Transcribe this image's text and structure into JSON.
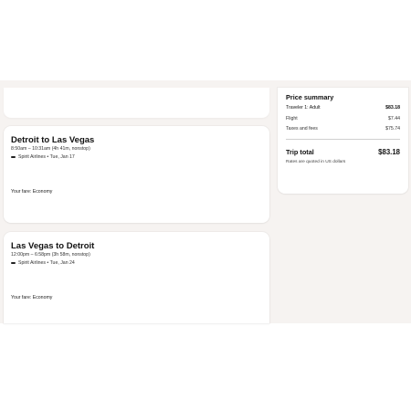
{
  "flights": [
    {
      "title": "Detroit to Las Vegas",
      "time": "8:50am – 10:31am (4h 41m, nonstop)",
      "airline_line": "Spirit Airlines • Tue, Jan 17",
      "fare": "Your fare: Economy"
    },
    {
      "title": "Las Vegas to Detroit",
      "time": "12:00pm – 6:58pm (3h 58m, nonstop)",
      "airline_line": "Spirit Airlines • Tue, Jan 24",
      "fare": "Your fare: Economy"
    }
  ],
  "price_summary": {
    "title": "Price summary",
    "traveler_label": "Traveler 1: Adult",
    "traveler_value": "$83.18",
    "flight_label": "Flight",
    "flight_value": "$7.44",
    "taxes_label": "Taxes and fees",
    "taxes_value": "$75.74",
    "total_label": "Trip total",
    "total_value": "$83.18",
    "note": "Rates are quoted in US dollars"
  },
  "icons": {
    "airline": "airline-logo-icon"
  },
  "colors": {
    "page_background": "#f6f3f1",
    "card_background": "#ffffff",
    "text": "#111111"
  }
}
